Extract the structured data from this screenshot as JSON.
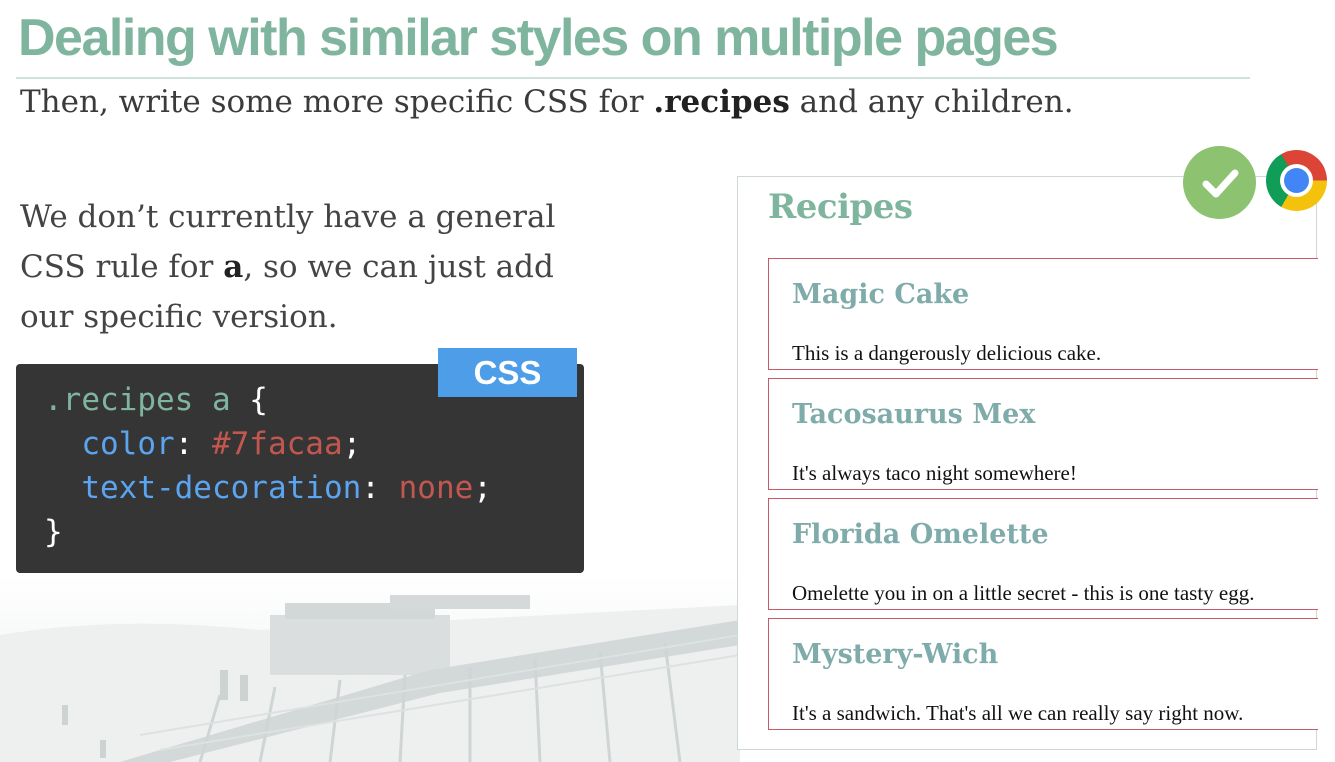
{
  "slide": {
    "title": "Dealing with similar styles on multiple pages",
    "subtitle_pre": "Then, write some more specific CSS for ",
    "subtitle_bold": ".recipes",
    "subtitle_post": " and any children.",
    "body_line1": "We don’t currently have a general",
    "body_line2_pre": "CSS rule for ",
    "body_line2_bold": "a",
    "body_line2_post": ", so we can just add",
    "body_line3": "our specific version."
  },
  "code": {
    "badge": "CSS",
    "selector": ".recipes a",
    "open_brace": " {",
    "prop1": "color",
    "val1": "#7facaa",
    "prop2": "text-decoration",
    "val2": "none",
    "colon": ": ",
    "semicolon": ";",
    "close_brace": "}"
  },
  "browser": {
    "heading": "Recipes",
    "check_icon": "checkmark-icon",
    "browser_icon": "chrome-icon",
    "recipes": [
      {
        "name": "Magic Cake",
        "description": "This is a dangerously delicious cake."
      },
      {
        "name": "Tacosaurus Mex",
        "description": "It's always taco night somewhere!"
      },
      {
        "name": "Florida Omelette",
        "description": "Omelette you in on a little secret - this is one tasty egg."
      },
      {
        "name": "Mystery-Wich",
        "description": "It's a sandwich. That's all we can really say right now."
      }
    ]
  },
  "colors": {
    "title": "#7fb59f",
    "link": "#7facaa",
    "badge": "#4d9de8",
    "code_bg": "#353535",
    "border": "#c65a6a"
  }
}
